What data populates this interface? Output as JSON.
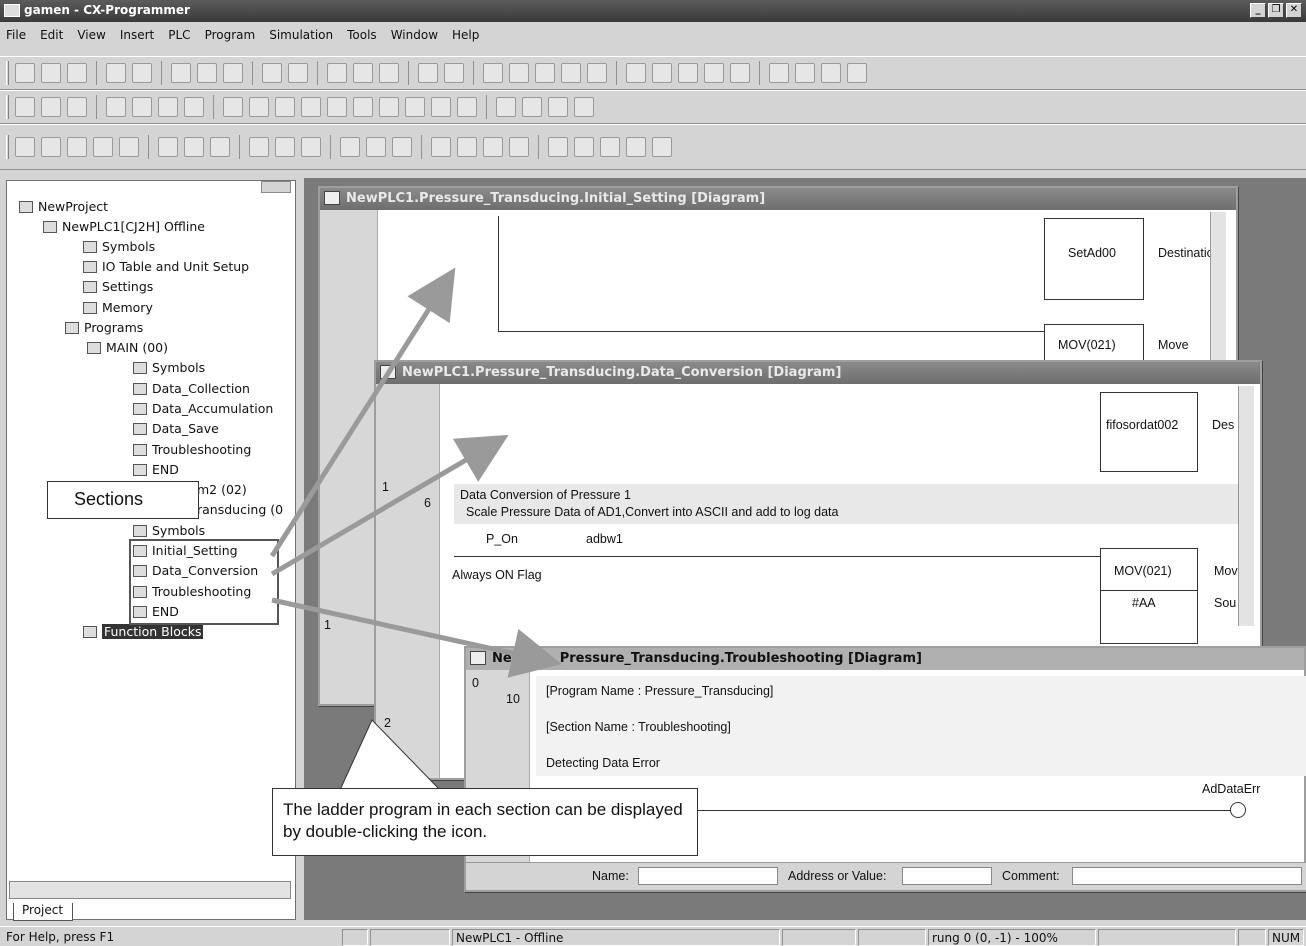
{
  "app_title": "gamen - CX-Programmer",
  "menu": [
    "File",
    "Edit",
    "View",
    "Insert",
    "PLC",
    "Program",
    "Simulation",
    "Tools",
    "Window",
    "Help"
  ],
  "project_tab": "Project",
  "tree": {
    "root": "NewProject",
    "plc": "NewPLC1[CJ2H] Offline",
    "symbols": "Symbols",
    "io_table": "IO Table and Unit Setup",
    "settings": "Settings",
    "memory": "Memory",
    "programs": "Programs",
    "main": "MAIN (00)",
    "main_sections": [
      "Symbols",
      "Data_Collection",
      "Data_Accumulation",
      "Data_Save",
      "Troubleshooting",
      "END"
    ],
    "prog2_partial": "m2 (02)",
    "prog3_partial": "ransducing (0",
    "prog3_sections": [
      "Symbols",
      "Initial_Setting",
      "Data_Conversion",
      "Troubleshooting",
      "END"
    ],
    "function_blocks": "Function Blocks"
  },
  "callout_sections": "Sections",
  "callout_bottom": "The ladder program in each section can be displayed by double-clicking the icon.",
  "win1": {
    "title": "NewPLC1.Pressure_Transducing.Initial_Setting [Diagram]",
    "setad": "SetAd00",
    "dest": "Destinatic",
    "mov": "MOV(021)",
    "move": "Move",
    "rung_a": "1"
  },
  "win2": {
    "title": "NewPLC1.Pressure_Transducing.Data_Conversion [Diagram]",
    "fifo": "fifosordat002",
    "des": "Des",
    "row_num": "1",
    "step": "6",
    "comment1": "Data Conversion of Pressure 1",
    "comment2": "Scale Pressure Data of AD1,Convert into ASCII and add to log data",
    "pon": "P_On",
    "adbw": "adbw1",
    "always": "Always ON Flag",
    "mov": "MOV(021)",
    "mov_r": "Mov",
    "aa": "#AA",
    "sou": "Sou",
    "rung2": "2"
  },
  "win3": {
    "title_a": "New",
    "title_b": "Pressure_Transducing.Troubleshooting [Diagram]",
    "row_num": "0",
    "step": "10",
    "c1": "[Program Name : Pressure_Transducing]",
    "c2": "[Section Name : Troubleshooting]",
    "c3": "Detecting Data Error",
    "coil": "AdDataErr",
    "name_lbl": "Name:",
    "addr_lbl": "Address or Value:",
    "comment_lbl": "Comment:"
  },
  "status": {
    "help": "For Help, press F1",
    "plc": "NewPLC1 - Offline",
    "rung": "rung 0 (0, -1) - 100%",
    "num": "NUM"
  }
}
